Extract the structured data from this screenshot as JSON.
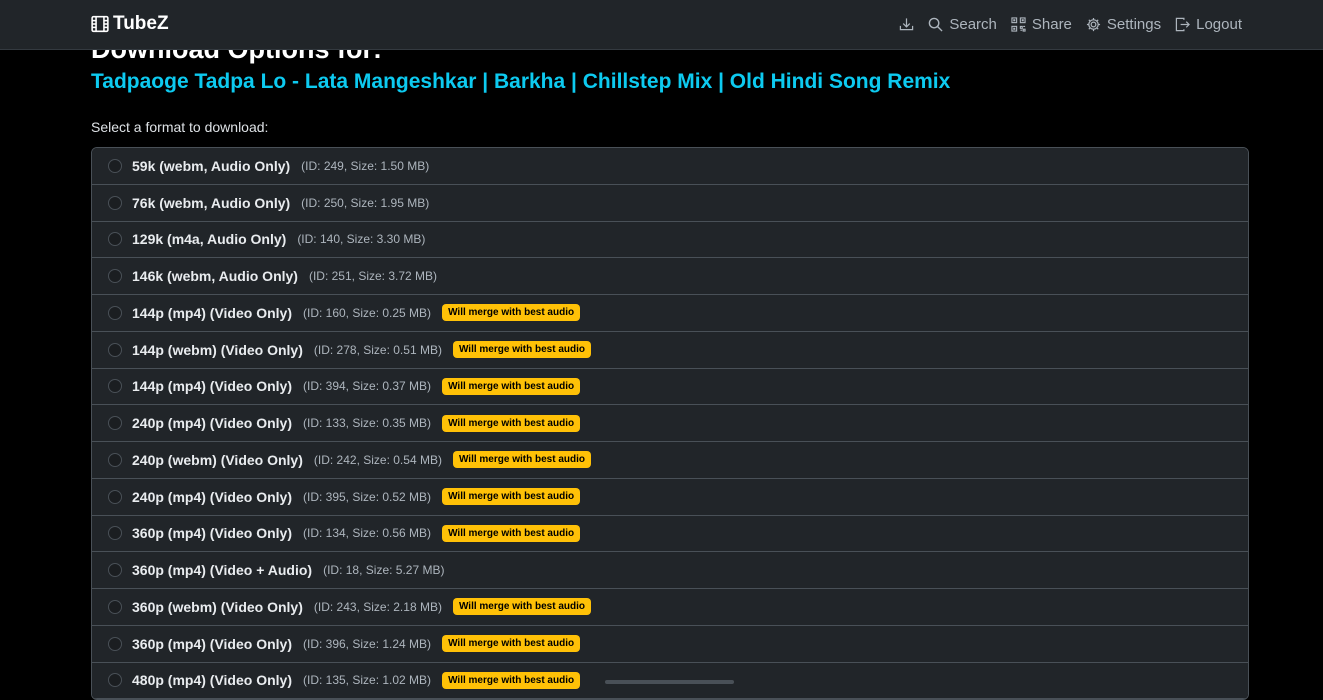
{
  "navbar": {
    "brand": "TubeZ",
    "items": [
      {
        "icon": "download-icon",
        "label": ""
      },
      {
        "icon": "search-icon",
        "label": "Search"
      },
      {
        "icon": "qr-code-icon",
        "label": "Share"
      },
      {
        "icon": "gear-icon",
        "label": "Settings"
      },
      {
        "icon": "logout-icon",
        "label": "Logout"
      }
    ]
  },
  "page": {
    "heading": "Download Options for:",
    "video_title": "Tadpaoge Tadpa Lo - Lata Mangeshkar | Barkha | Chillstep Mix | Old Hindi Song Remix",
    "select_label": "Select a format to download:"
  },
  "formats": [
    {
      "label": "59k (webm, Audio Only)",
      "meta": "(ID: 249, Size: 1.50 MB)",
      "badge": ""
    },
    {
      "label": "76k (webm, Audio Only)",
      "meta": "(ID: 250, Size: 1.95 MB)",
      "badge": ""
    },
    {
      "label": "129k (m4a, Audio Only)",
      "meta": "(ID: 140, Size: 3.30 MB)",
      "badge": ""
    },
    {
      "label": "146k (webm, Audio Only)",
      "meta": "(ID: 251, Size: 3.72 MB)",
      "badge": ""
    },
    {
      "label": "144p (mp4) (Video Only)",
      "meta": "(ID: 160, Size: 0.25 MB)",
      "badge": "Will merge with best audio"
    },
    {
      "label": "144p (webm) (Video Only)",
      "meta": "(ID: 278, Size: 0.51 MB)",
      "badge": "Will merge with best audio"
    },
    {
      "label": "144p (mp4) (Video Only)",
      "meta": "(ID: 394, Size: 0.37 MB)",
      "badge": "Will merge with best audio"
    },
    {
      "label": "240p (mp4) (Video Only)",
      "meta": "(ID: 133, Size: 0.35 MB)",
      "badge": "Will merge with best audio"
    },
    {
      "label": "240p (webm) (Video Only)",
      "meta": "(ID: 242, Size: 0.54 MB)",
      "badge": "Will merge with best audio"
    },
    {
      "label": "240p (mp4) (Video Only)",
      "meta": "(ID: 395, Size: 0.52 MB)",
      "badge": "Will merge with best audio"
    },
    {
      "label": "360p (mp4) (Video Only)",
      "meta": "(ID: 134, Size: 0.56 MB)",
      "badge": "Will merge with best audio"
    },
    {
      "label": "360p (mp4) (Video + Audio)",
      "meta": "(ID: 18, Size: 5.27 MB)",
      "badge": ""
    },
    {
      "label": "360p (webm) (Video Only)",
      "meta": "(ID: 243, Size: 2.18 MB)",
      "badge": "Will merge with best audio"
    },
    {
      "label": "360p (mp4) (Video Only)",
      "meta": "(ID: 396, Size: 1.24 MB)",
      "badge": "Will merge with best audio"
    },
    {
      "label": "480p (mp4) (Video Only)",
      "meta": "(ID: 135, Size: 1.02 MB)",
      "badge": "Will merge with best audio"
    }
  ],
  "colors": {
    "accent": "#0dcaf0",
    "badge": "#ffc107",
    "navbar": "#212529",
    "background": "#000000"
  }
}
